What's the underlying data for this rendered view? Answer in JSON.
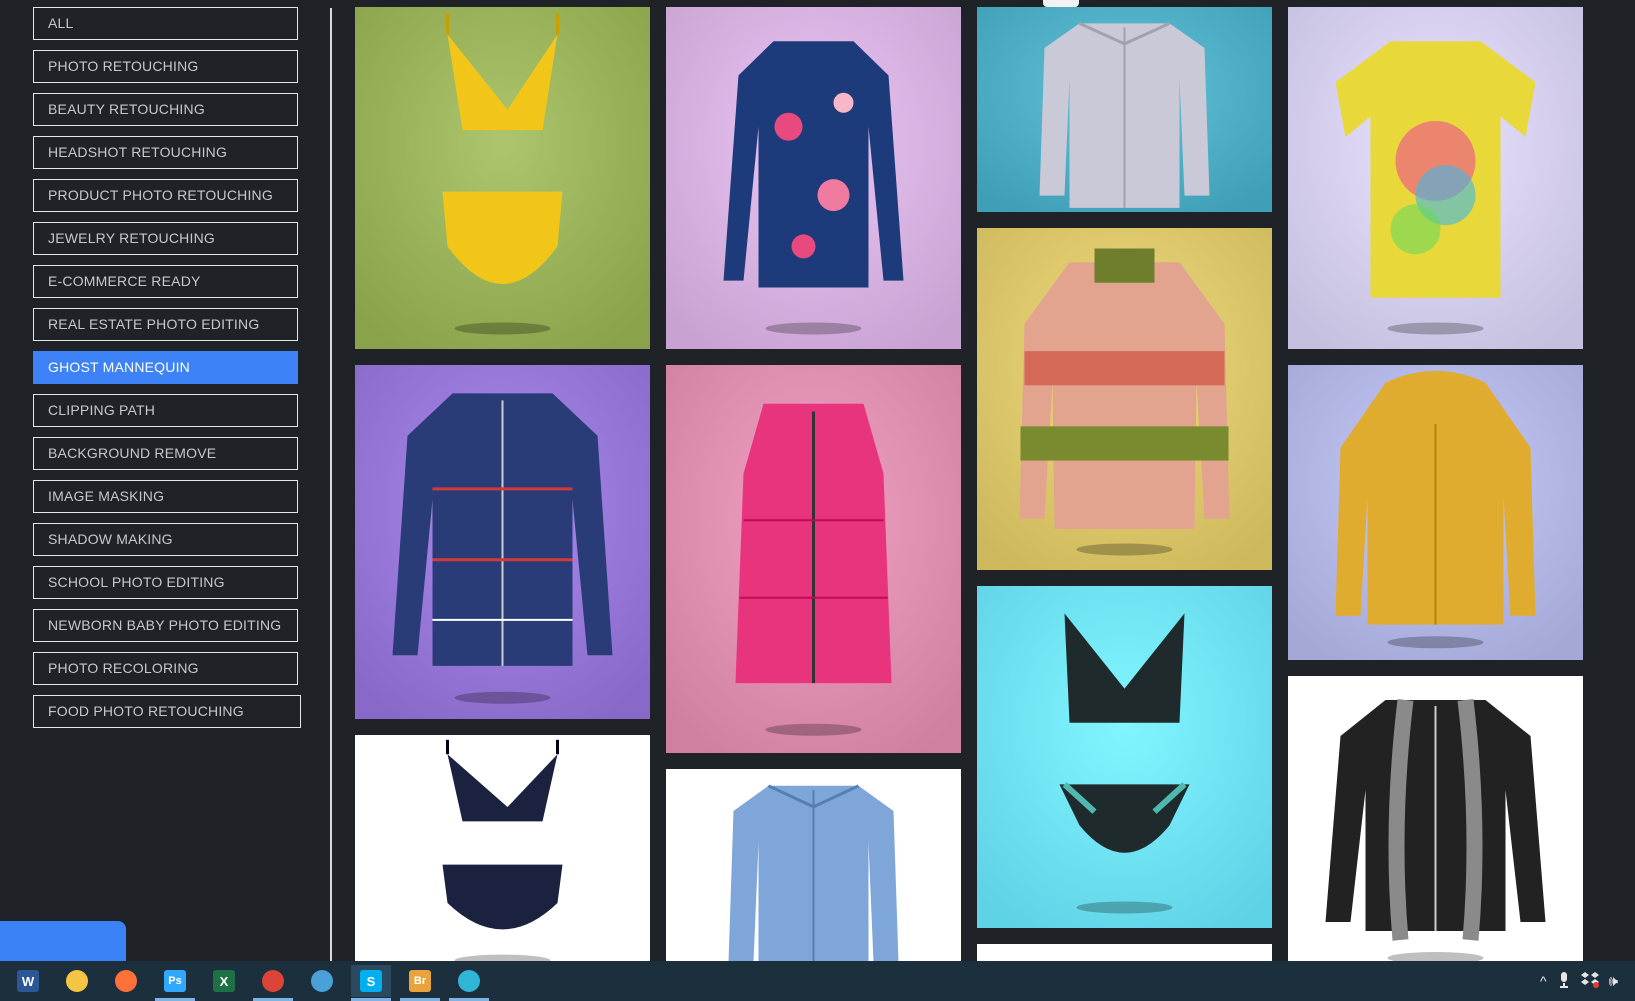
{
  "categories": [
    {
      "label": "ALL",
      "active": false
    },
    {
      "label": "PHOTO RETOUCHING",
      "active": false
    },
    {
      "label": "BEAUTY RETOUCHING",
      "active": false
    },
    {
      "label": "HEADSHOT RETOUCHING",
      "active": false
    },
    {
      "label": "PRODUCT PHOTO RETOUCHING",
      "active": false
    },
    {
      "label": "JEWELRY RETOUCHING",
      "active": false
    },
    {
      "label": "E-COMMERCE READY",
      "active": false
    },
    {
      "label": "REAL ESTATE PHOTO EDITING",
      "active": false
    },
    {
      "label": "GHOST MANNEQUIN",
      "active": true
    },
    {
      "label": "CLIPPING PATH",
      "active": false
    },
    {
      "label": "BACKGROUND REMOVE",
      "active": false
    },
    {
      "label": "IMAGE MASKING",
      "active": false
    },
    {
      "label": "SHADOW MAKING",
      "active": false
    },
    {
      "label": "SCHOOL PHOTO EDITING",
      "active": false
    },
    {
      "label": "NEWBORN BABY PHOTO EDITING",
      "active": false
    },
    {
      "label": "PHOTO RECOLORING",
      "active": false
    },
    {
      "label": "FOOD PHOTO RETOUCHING",
      "active": false
    }
  ],
  "gallery": [
    {
      "name": "yellow-bikini-photo",
      "bg": "#8aa24a",
      "garment": "bikini",
      "color": "#f2c619"
    },
    {
      "name": "floral-bodysuit-photo",
      "bg": "#c8a3d2",
      "garment": "longsleeve",
      "color": "#1d3b7a"
    },
    {
      "name": "plaid-shirt-photo",
      "bg": "#3f9fb7",
      "garment": "shirt",
      "color": "#c9c9d8"
    },
    {
      "name": "tie-dye-tshirt-photo",
      "bg": "#c6c0e0",
      "garment": "tshirt",
      "color": "#e8d83a"
    },
    {
      "name": "plaid-puffer-jacket-photo",
      "bg": "#8868c8",
      "garment": "jacket",
      "color": "#2a3c78"
    },
    {
      "name": "pink-puffer-vest-photo",
      "bg": "#cf7fa0",
      "garment": "vest",
      "color": "#e8337d"
    },
    {
      "name": "striped-sweater-photo",
      "bg": "#cdb95c",
      "garment": "sweater",
      "color": "#e3a48f"
    },
    {
      "name": "yellow-fur-hoodie-photo",
      "bg": "#a4a8d6",
      "garment": "hoodie",
      "color": "#e0ac30"
    },
    {
      "name": "lace-lingerie-photo",
      "bg": "#5fd3e6",
      "garment": "lingerie",
      "color": "#1e2a2c"
    },
    {
      "name": "polka-dot-bikini-photo",
      "bg": "#ffffff",
      "garment": "bikini",
      "color": "#1b2240"
    },
    {
      "name": "blue-shirt-photo",
      "bg": "#ffffff",
      "garment": "shirt",
      "color": "#7ea6d8"
    },
    {
      "name": "fur-trim-coat-photo",
      "bg": "#ffffff",
      "garment": "coat",
      "color": "#222222"
    },
    {
      "name": "partial-photo",
      "bg": "#ffffff",
      "garment": "none",
      "color": "#ffffff"
    }
  ],
  "taskbar": {
    "apps": [
      {
        "name": "word-icon",
        "glyph": "W",
        "color": "#2b5797"
      },
      {
        "name": "file-explorer-icon",
        "glyph": "",
        "color": "#f4c542"
      },
      {
        "name": "firefox-icon",
        "glyph": "",
        "color": "#ff7139"
      },
      {
        "name": "photoshop-icon",
        "glyph": "Ps",
        "color": "#31a8ff"
      },
      {
        "name": "excel-icon",
        "glyph": "X",
        "color": "#1e7145"
      },
      {
        "name": "chrome-icon",
        "glyph": "",
        "color": "#db4437"
      },
      {
        "name": "photos-icon",
        "glyph": "",
        "color": "#4aa0d8"
      },
      {
        "name": "skype-icon",
        "glyph": "S",
        "color": "#00aff0"
      },
      {
        "name": "bridge-icon",
        "glyph": "Br",
        "color": "#e8a33d"
      },
      {
        "name": "edge-icon",
        "glyph": "",
        "color": "#2fb5d6"
      }
    ],
    "tray": {
      "chevron": "^",
      "volume": "🕪"
    }
  }
}
